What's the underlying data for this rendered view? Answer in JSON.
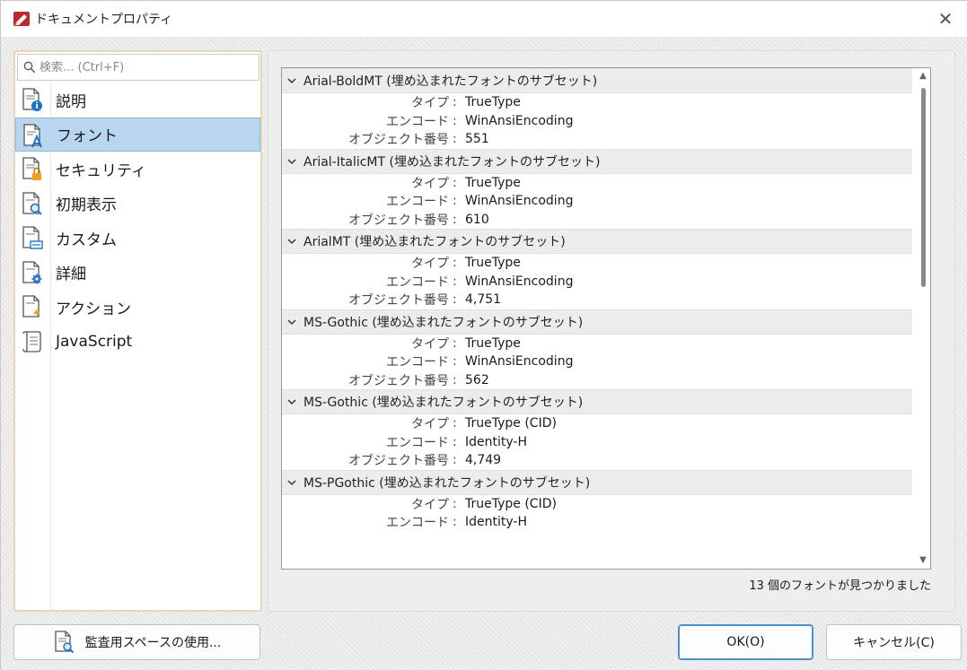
{
  "window": {
    "title": "ドキュメントプロパティ",
    "close_glyph": "✕"
  },
  "search": {
    "placeholder": "検索... (Ctrl+F)"
  },
  "nav": {
    "selected": "フォント",
    "items": [
      {
        "label": "説明",
        "icon": "document-info-icon"
      },
      {
        "label": "フォント",
        "icon": "document-font-icon"
      },
      {
        "label": "セキュリティ",
        "icon": "document-lock-icon"
      },
      {
        "label": "初期表示",
        "icon": "document-magnifier-icon"
      },
      {
        "label": "カスタム",
        "icon": "document-custom-icon"
      },
      {
        "label": "詳細",
        "icon": "document-gear-icon"
      },
      {
        "label": "アクション",
        "icon": "document-lightning-icon"
      },
      {
        "label": "JavaScript",
        "icon": "script-scroll-icon"
      }
    ]
  },
  "fonts": {
    "field_labels": {
      "type": "タイプ",
      "encoding": "エンコード",
      "object_number": "オブジェクト番号",
      "separator": ":"
    },
    "groups": [
      {
        "name": "Arial-BoldMT (埋め込まれたフォントのサブセット)",
        "type": "TrueType",
        "encoding": "WinAnsiEncoding",
        "object_number": "551"
      },
      {
        "name": "Arial-ItalicMT (埋め込まれたフォントのサブセット)",
        "type": "TrueType",
        "encoding": "WinAnsiEncoding",
        "object_number": "610"
      },
      {
        "name": "ArialMT (埋め込まれたフォントのサブセット)",
        "type": "TrueType",
        "encoding": "WinAnsiEncoding",
        "object_number": "4,751"
      },
      {
        "name": "MS-Gothic (埋め込まれたフォントのサブセット)",
        "type": "TrueType",
        "encoding": "WinAnsiEncoding",
        "object_number": "562"
      },
      {
        "name": "MS-Gothic (埋め込まれたフォントのサブセット)",
        "type": "TrueType (CID)",
        "encoding": "Identity-H",
        "object_number": "4,749"
      },
      {
        "name": "MS-PGothic (埋め込まれたフォントのサブセット)",
        "type": "TrueType (CID)",
        "encoding": "Identity-H",
        "object_number": ""
      }
    ],
    "found_count": "13 個のフォントが見つかりました"
  },
  "buttons": {
    "audit": "監査用スペースの使用...",
    "ok": "OK(O)",
    "cancel": "キャンセル(C)"
  },
  "colors": {
    "selection": "#b9d6ef",
    "accent_border": "#4f8dd3",
    "left_panel_border": "#e8d6b4"
  }
}
